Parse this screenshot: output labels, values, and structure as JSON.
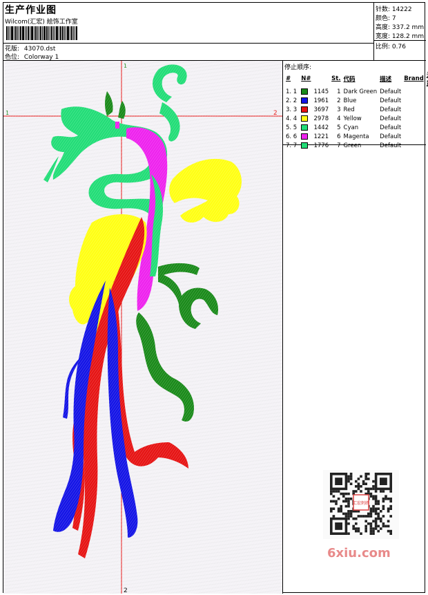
{
  "header": {
    "title": "生产作业图",
    "company": "Wilcom(汇宏) 絵饰工作室",
    "pattern_label": "花版:",
    "pattern_value": "43070.dst",
    "colorway_label": "色位:",
    "colorway_value": "Colorway 1"
  },
  "stats": {
    "stitches_label": "针数:",
    "stitches_value": "14222",
    "colors_label": "颜色:",
    "colors_value": "7",
    "height_label": "高度:",
    "height_value": "337.2 mm",
    "width_label": "宽度:",
    "width_value": "128.2 mm",
    "scale_label": "比例:",
    "scale_value": "0.76"
  },
  "markers": {
    "top": "1",
    "left": "1",
    "right": "2",
    "bottom": "2"
  },
  "panel": {
    "stop_sequence_label": "停止顺序:",
    "columns": [
      "#",
      "N#",
      "St.",
      "代码",
      "描述",
      "Brand",
      "元素"
    ],
    "rows": [
      {
        "idx": "1. 1",
        "color": "#1a8a1a",
        "st": "1145",
        "code": "1",
        "desc": "Dark Green",
        "brand": "Default"
      },
      {
        "idx": "2. 2",
        "color": "#1414e6",
        "st": "1961",
        "code": "2",
        "desc": "Blue",
        "brand": "Default"
      },
      {
        "idx": "3. 3",
        "color": "#e61414",
        "st": "3697",
        "code": "3",
        "desc": "Red",
        "brand": "Default"
      },
      {
        "idx": "4. 4",
        "color": "#ffff14",
        "st": "2978",
        "code": "4",
        "desc": "Yellow",
        "brand": "Default"
      },
      {
        "idx": "5. 5",
        "color": "#22dd77",
        "st": "1442",
        "code": "5",
        "desc": "Cyan",
        "brand": "Default"
      },
      {
        "idx": "6. 6",
        "color": "#ee22ee",
        "st": "1221",
        "code": "6",
        "desc": "Magenta",
        "brand": "Default"
      },
      {
        "idx": "7. 7",
        "color": "#22dd77",
        "st": "1776",
        "code": "7",
        "desc": "Green",
        "brand": "Default"
      }
    ]
  },
  "watermark": "6xiu.com",
  "qr_badge": "汇宏刺绣"
}
